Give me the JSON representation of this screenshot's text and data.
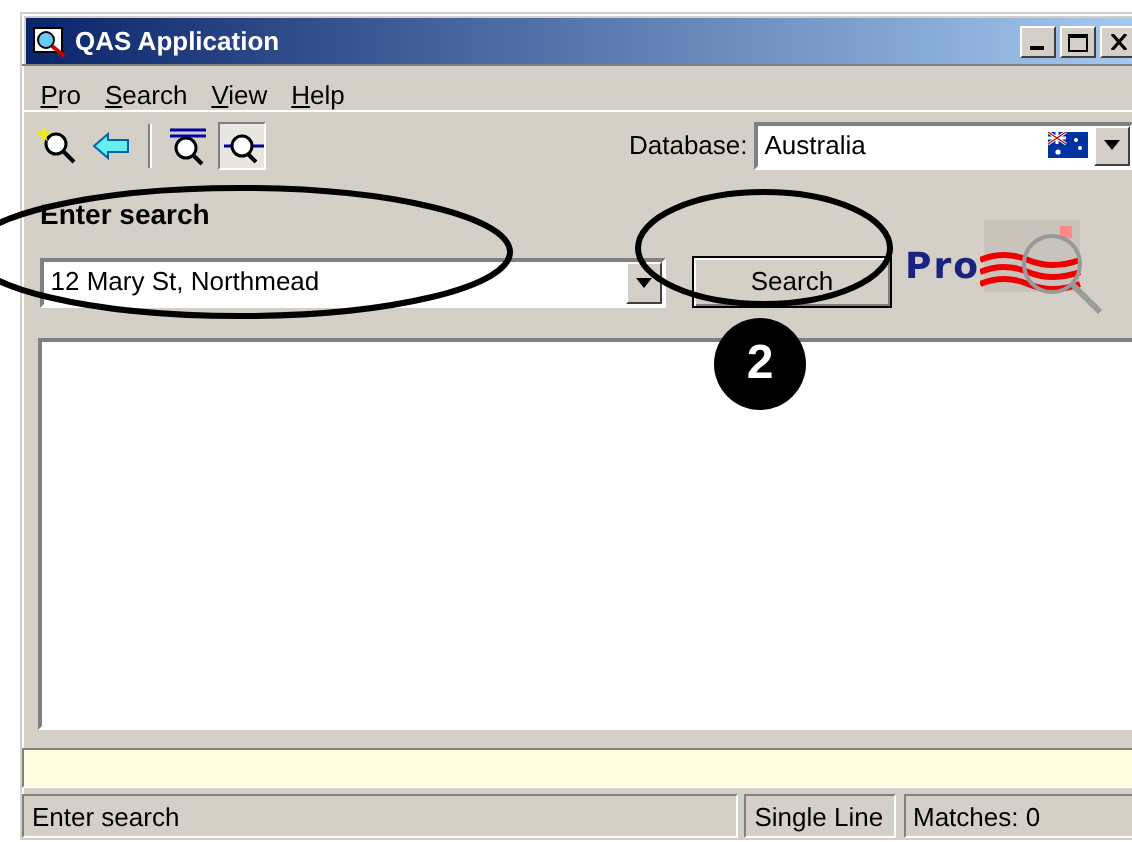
{
  "window": {
    "title": "QAS Application"
  },
  "menu": [
    "Pro",
    "Search",
    "View",
    "Help"
  ],
  "toolbar": [
    {
      "kind": "new",
      "pressed": false
    },
    {
      "kind": "back",
      "pressed": false
    },
    {
      "kind": "lines",
      "pressed": false
    },
    {
      "kind": "dashes",
      "pressed": true
    }
  ],
  "database": {
    "label": "Database:",
    "value": "Australia"
  },
  "search": {
    "label": "Enter search",
    "value": "12 Mary St, Northmead",
    "button": "Search"
  },
  "logo": {
    "text": "Pro"
  },
  "annotation": {
    "number": "2"
  },
  "status_bar": [
    "Enter search",
    "Single Line",
    "Matches: 0"
  ]
}
